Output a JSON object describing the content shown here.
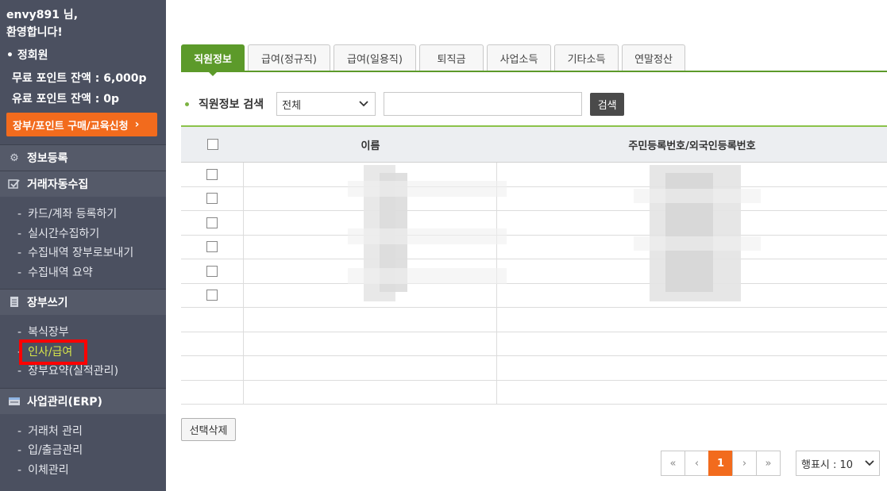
{
  "user": {
    "greeting_line1": "envy891 님,",
    "greeting_line2": "환영합니다!",
    "membership": "• 정회원",
    "free_points": "무료 포인트 잔액 : 6,000p",
    "paid_points": "유료 포인트 잔액 : 0p",
    "buy_button": "장부/포인트 구매/교육신청",
    "buy_button_icon": "chevron-right-icon"
  },
  "sidebar": {
    "sections": [
      {
        "title": "정보등록",
        "icon": "gear-icon",
        "items": []
      },
      {
        "title": "거래자동수집",
        "icon": "collect-icon",
        "items": [
          "카드/계좌 등록하기",
          "실시간수집하기",
          "수집내역 장부로보내기",
          "수집내역 요약"
        ]
      },
      {
        "title": "장부쓰기",
        "icon": "ledger-icon",
        "items": [
          "복식장부",
          "인사/급여",
          "장부요약(실적관리)"
        ]
      },
      {
        "title": "사업관리(ERP)",
        "icon": "erp-icon",
        "items": [
          "거래처 관리",
          "입/출금관리",
          "이체관리"
        ]
      }
    ],
    "highlighted_item": "인사/급여",
    "item_dash": "-"
  },
  "tabs": [
    {
      "label": "직원정보",
      "active": true
    },
    {
      "label": "급여(정규직)",
      "active": false
    },
    {
      "label": "급여(일용직)",
      "active": false
    },
    {
      "label": "퇴직금",
      "active": false
    },
    {
      "label": "사업소득",
      "active": false
    },
    {
      "label": "기타소득",
      "active": false
    },
    {
      "label": "연말정산",
      "active": false
    }
  ],
  "search": {
    "label": "직원정보 검색",
    "select_value": "전체",
    "input_value": "",
    "button": "검색"
  },
  "table": {
    "columns": [
      "이름",
      "주민등록번호/외국인등록번호"
    ],
    "filled_rows": 6,
    "empty_rows": 4
  },
  "actions": {
    "delete_selected": "선택삭제"
  },
  "pagination": {
    "first": "«",
    "prev": "‹",
    "current": "1",
    "next": "›",
    "last": "»",
    "rows_per_page": "행표시 : 10"
  },
  "colors": {
    "sidebar_bg": "#4b5060",
    "accent_green": "#5c9a2a",
    "accent_orange": "#f26b1d",
    "highlight_red": "#ff0000"
  }
}
